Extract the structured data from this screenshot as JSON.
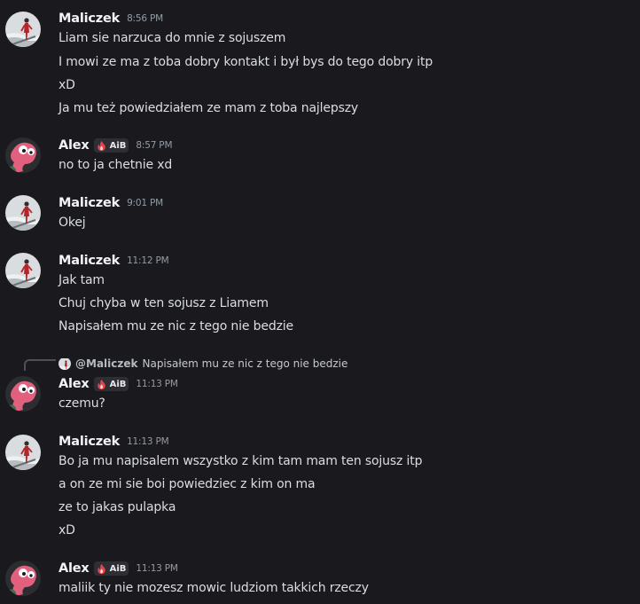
{
  "users": {
    "maliczek": {
      "name": "Maliczek"
    },
    "alex": {
      "name": "Alex",
      "badge": "AiB"
    }
  },
  "messages": [
    {
      "time": "8:56 PM",
      "lines": [
        "Liam sie narzuca do mnie z sojuszem",
        "I mowi ze ma z toba dobry kontakt i był bys do tego dobry itp",
        "xD",
        "Ja mu też powiedziałem ze mam z toba najlepszy"
      ]
    },
    {
      "time": "8:57 PM",
      "lines": [
        "no to ja chetnie xd"
      ]
    },
    {
      "time": "9:01 PM",
      "lines": [
        "Okej"
      ]
    },
    {
      "time": "11:12 PM",
      "lines": [
        "Jak tam",
        "Chuj chyba w ten sojusz z Liamem",
        "Napisałem mu ze nic z tego nie bedzie"
      ]
    },
    {
      "time": "11:13 PM",
      "reply": {
        "mention": "@Maliczek",
        "text": "Napisałem mu ze nic z tego nie bedzie"
      },
      "lines": [
        "czemu?"
      ]
    },
    {
      "time": "11:13 PM",
      "lines": [
        "Bo ja mu napisalem wszystko z kim tam mam ten sojusz itp",
        "a on ze mi sie boi powiedziec z kim on ma",
        "ze to jakas pulapka",
        "xD"
      ]
    },
    {
      "time": "11:13 PM",
      "lines": [
        "maliik ty nie mozesz mowic ludziom takkich rzeczy"
      ]
    }
  ],
  "colors": {
    "background": "#1a1a1e",
    "author": "#f2f3f5",
    "text": "#dbdee1",
    "timestamp": "#949ba4",
    "badge_bg": "#2e2f35"
  },
  "icons": {
    "maliczek_avatar": "snowy-figure-avatar",
    "alex_avatar": "pink-blob-avatar",
    "badge": "fire-icon"
  }
}
